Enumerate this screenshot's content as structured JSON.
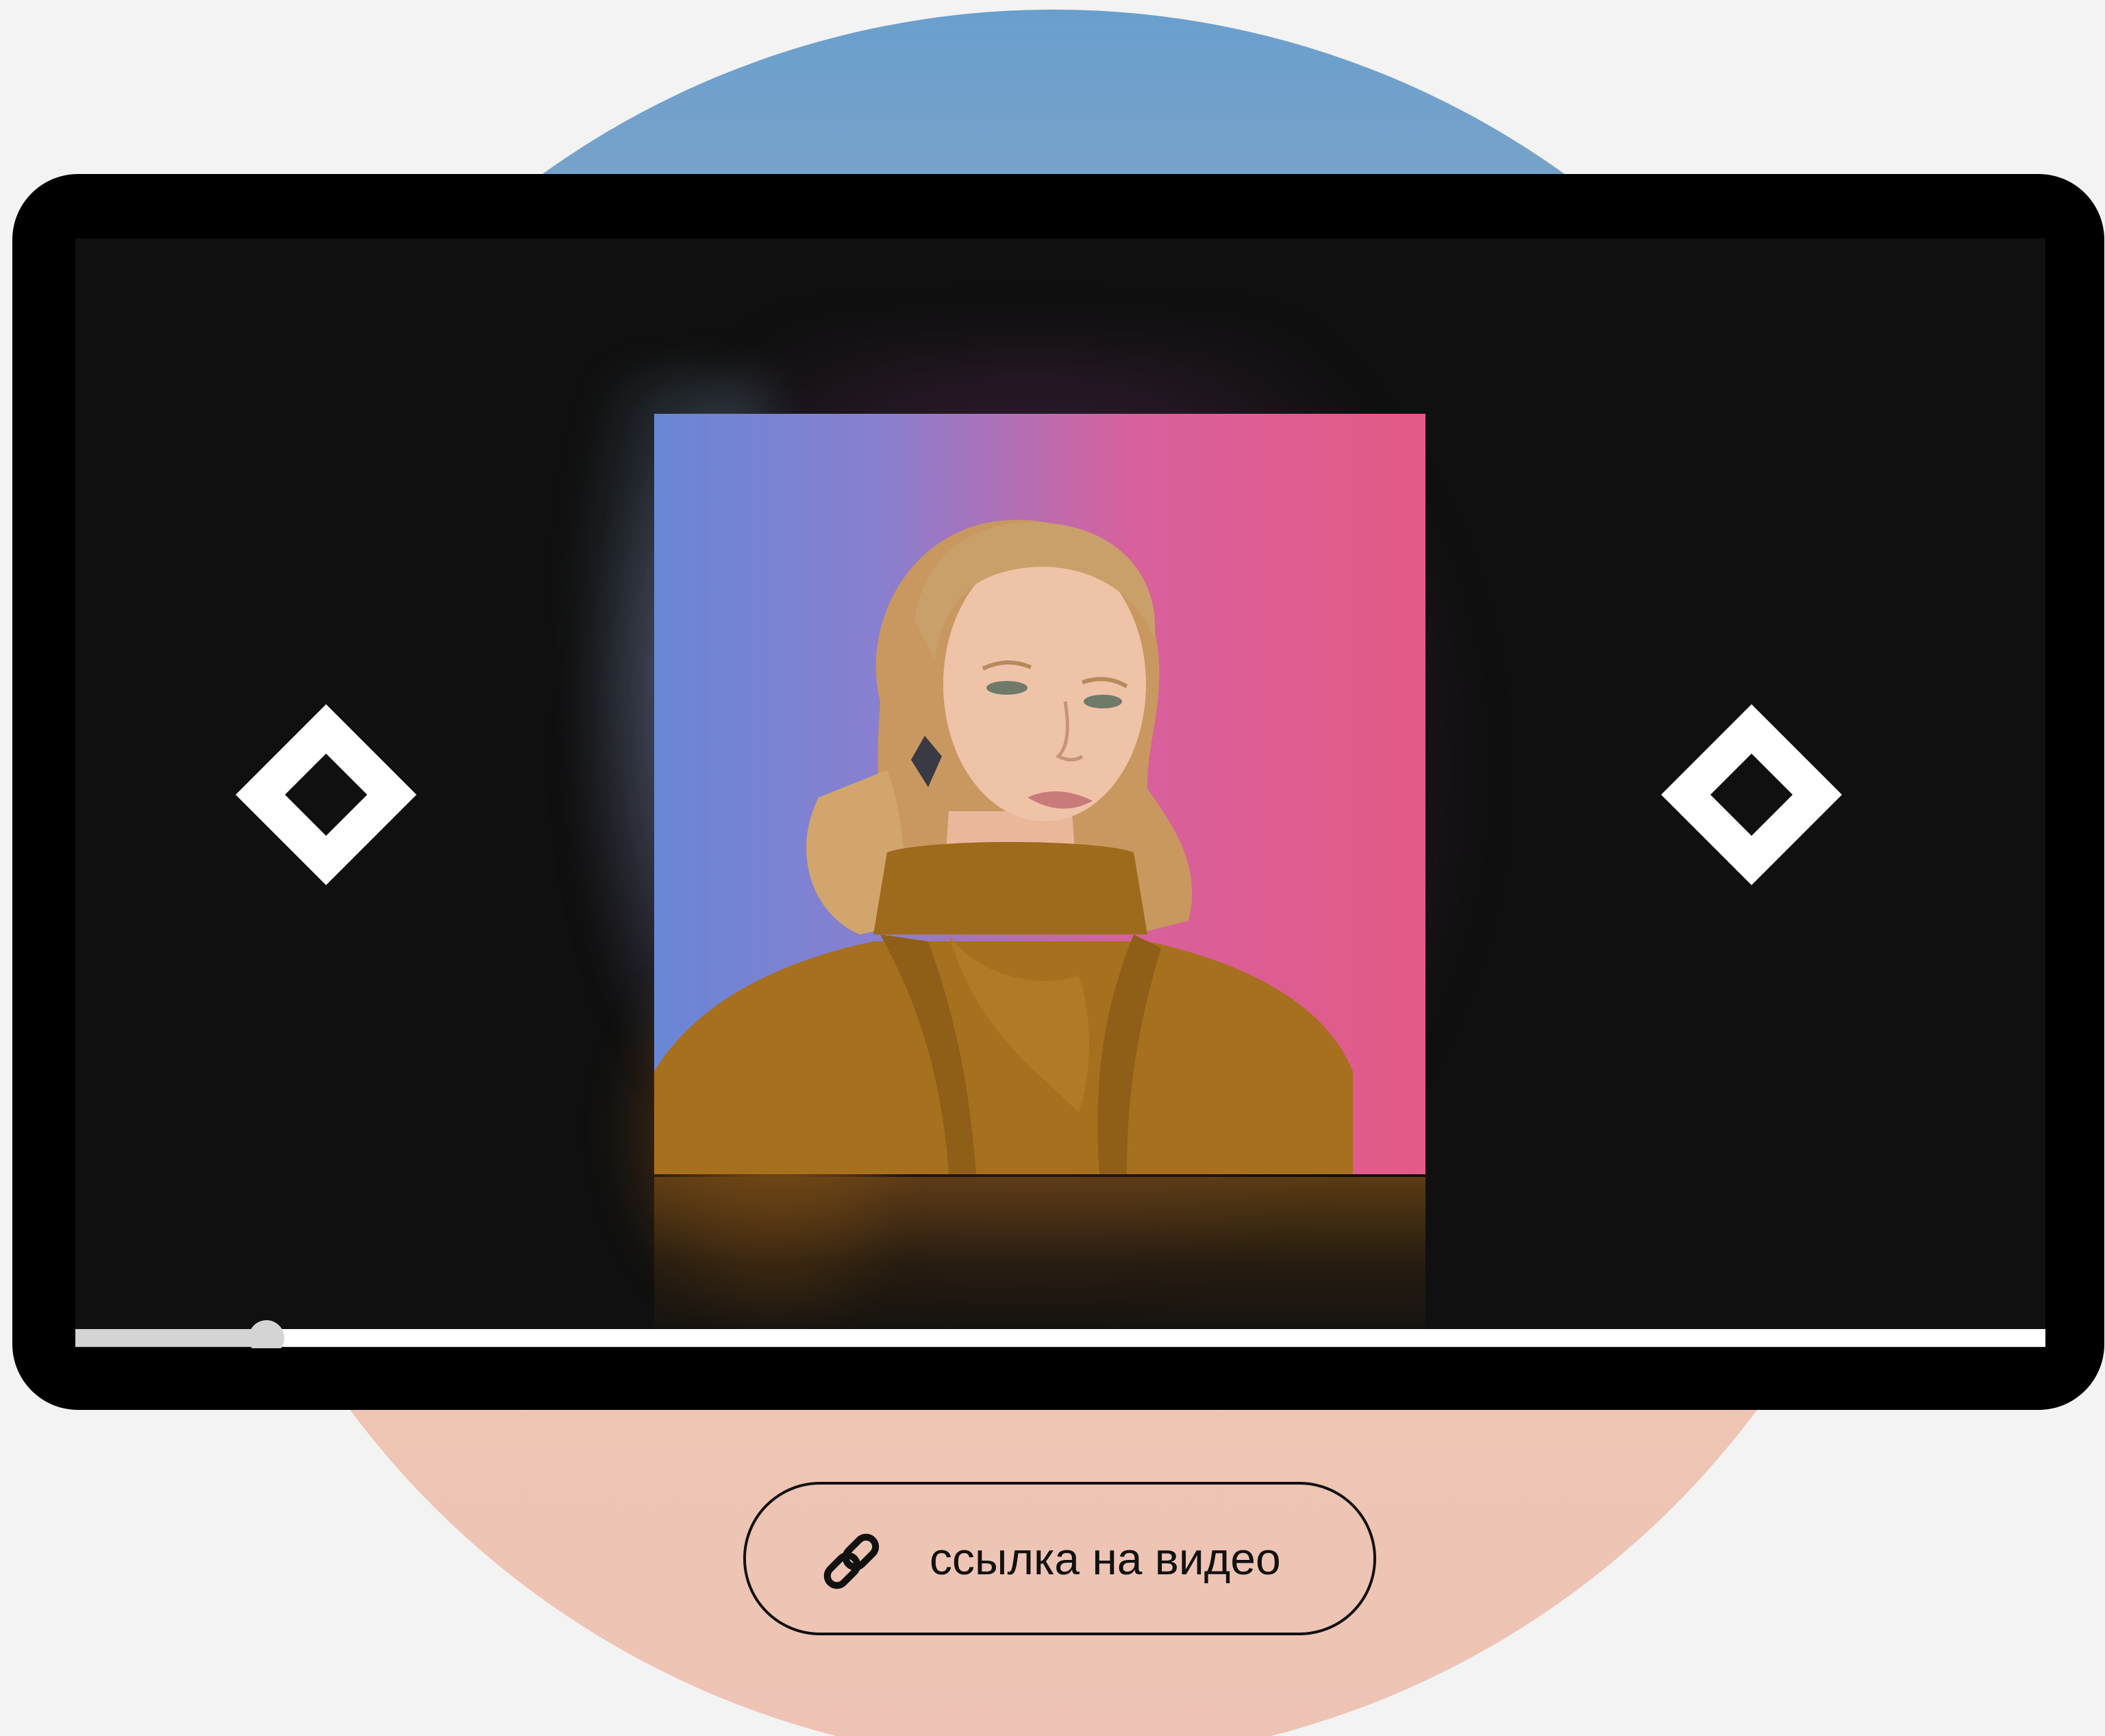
{
  "player": {
    "progress_fraction": 0.097,
    "prev_icon": "diamond-outline-icon",
    "next_icon": "diamond-outline-icon"
  },
  "link_button": {
    "icon": "link-chain-icon",
    "label": "ссылка на видео"
  },
  "colors": {
    "page_background": "#f3f3f3",
    "circle_top": "#6a9fcd",
    "circle_bottom": "#efc6b2",
    "device_frame": "#000000",
    "screen_background": "#101010",
    "photo_gradient_left": "#6a86d6",
    "photo_gradient_right": "#e35a86",
    "progress_track": "#ffffff",
    "progress_fill": "#d4d4d4"
  }
}
